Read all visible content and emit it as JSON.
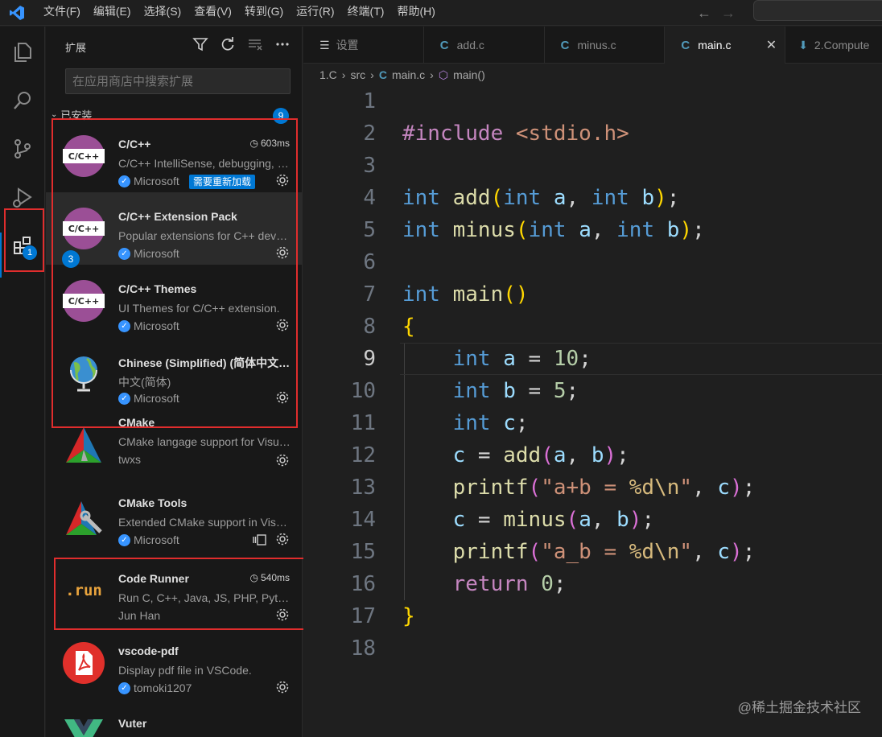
{
  "menu": [
    "文件(F)",
    "编辑(E)",
    "选择(S)",
    "查看(V)",
    "转到(G)",
    "运行(R)",
    "终端(T)",
    "帮助(H)"
  ],
  "activity_badge": "1",
  "sidebar": {
    "title": "扩展",
    "search_placeholder": "在应用商店中搜索扩展",
    "section_label": "已安装",
    "section_count": "9",
    "extensions": [
      {
        "name": "C/C++",
        "desc": "C/C++ IntelliSense, debugging, and code browsing.",
        "publisher": "Microsoft",
        "time": "603ms",
        "tag": "需要重新加载",
        "logo": "C/C++"
      },
      {
        "name": "C/C++ Extension Pack",
        "desc": "Popular extensions for C++ development in Visual Studio Code.",
        "publisher": "Microsoft",
        "pack_count": "3",
        "logo": "C/C++"
      },
      {
        "name": "C/C++ Themes",
        "desc": "UI Themes for C/C++ extension.",
        "publisher": "Microsoft",
        "logo": "C/C++"
      },
      {
        "name": "Chinese (Simplified) (简体中文) Language Pack",
        "desc": "中文(简体)",
        "publisher": "Microsoft"
      },
      {
        "name": "CMake",
        "desc": "CMake langage support for Visual Studio Code",
        "publisher": "twxs"
      },
      {
        "name": "CMake Tools",
        "desc": "Extended CMake support in Visual Studio Code",
        "publisher": "Microsoft"
      },
      {
        "name": "Code Runner",
        "desc": "Run C, C++, Java, JS, PHP, Python, Perl, Ruby, Go...",
        "publisher": "Jun Han",
        "time": "540ms",
        "logo": ".run"
      },
      {
        "name": "vscode-pdf",
        "desc": "Display pdf file in VSCode.",
        "publisher": "tomoki1207"
      },
      {
        "name": "Vuter",
        "desc": "",
        "publisher": ""
      }
    ]
  },
  "tabs": [
    {
      "label": "设置"
    },
    {
      "label": "add.c",
      "icon": "C"
    },
    {
      "label": "minus.c",
      "icon": "C"
    },
    {
      "label": "main.c",
      "icon": "C",
      "active": true
    },
    {
      "label": "2.Compute"
    }
  ],
  "breadcrumb": {
    "a": "1.C",
    "b": "src",
    "icon": "C",
    "c": "main.c",
    "d": "main()"
  },
  "code": {
    "line_numbers": [
      "1",
      "2",
      "3",
      "4",
      "5",
      "6",
      "7",
      "8",
      "9",
      "10",
      "11",
      "12",
      "13",
      "14",
      "15",
      "16",
      "17",
      "18"
    ],
    "current_line": 9,
    "l2_inc": "#include",
    "l2_hdr": "<stdio.h>",
    "int": "int",
    "return": "return",
    "add": "add",
    "minus": "minus",
    "main": "main",
    "printf": "printf",
    "a": "a",
    "b": "b",
    "c": "c",
    "ten": "10",
    "five": "5",
    "zero": "0",
    "s1a": "\"a+b = ",
    "s2a": "\"a_b = ",
    "fmt": "%d",
    "nl": "\\n",
    "q": "\""
  },
  "watermark": "@稀土掘金技术社区"
}
